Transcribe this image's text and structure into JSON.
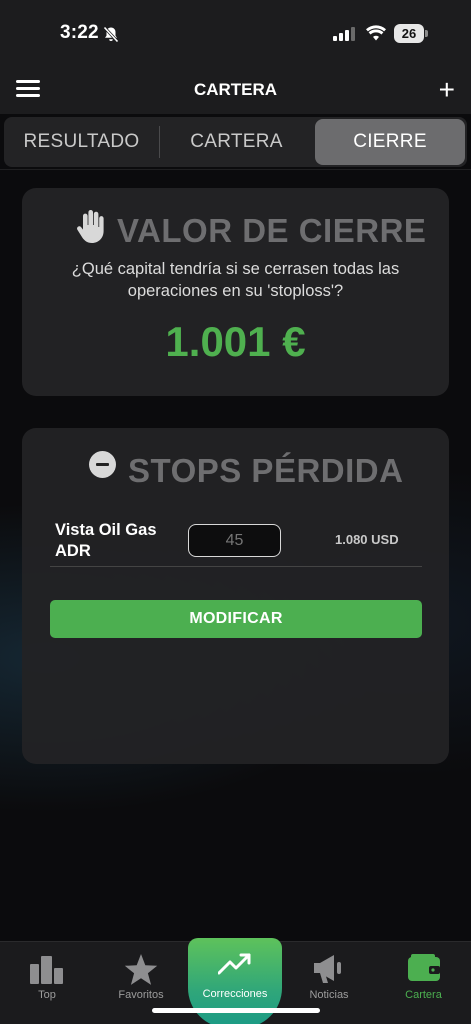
{
  "status_bar": {
    "time": "3:22",
    "battery": "26"
  },
  "nav": {
    "title": "CARTERA"
  },
  "segments": [
    {
      "label": "RESULTADO",
      "selected": false
    },
    {
      "label": "CARTERA",
      "selected": false
    },
    {
      "label": "CIERRE",
      "selected": true
    }
  ],
  "closing_card": {
    "title": "VALOR DE CIERRE",
    "description": "¿Qué capital tendría si se cerrasen todas las operaciones en su 'stoploss'?",
    "value": "1.001 €"
  },
  "stops_card": {
    "title": "STOPS PÉRDIDA",
    "rows": [
      {
        "name": "Vista Oil Gas ADR",
        "input_placeholder": "45",
        "value": "1.080 USD"
      }
    ],
    "button_label": "MODIFICAR"
  },
  "tabs": [
    {
      "label": "Top",
      "icon": "bar-chart-icon"
    },
    {
      "label": "Favoritos",
      "icon": "star-icon"
    },
    {
      "label": "Correcciones",
      "icon": "trending-up-icon"
    },
    {
      "label": "Noticias",
      "icon": "megaphone-icon"
    },
    {
      "label": "Cartera",
      "icon": "wallet-icon",
      "active": true
    }
  ],
  "colors": {
    "accent_green": "#4caf50",
    "value_green": "#4fb04f",
    "background": "#0b0b0d",
    "card": "#222224"
  }
}
